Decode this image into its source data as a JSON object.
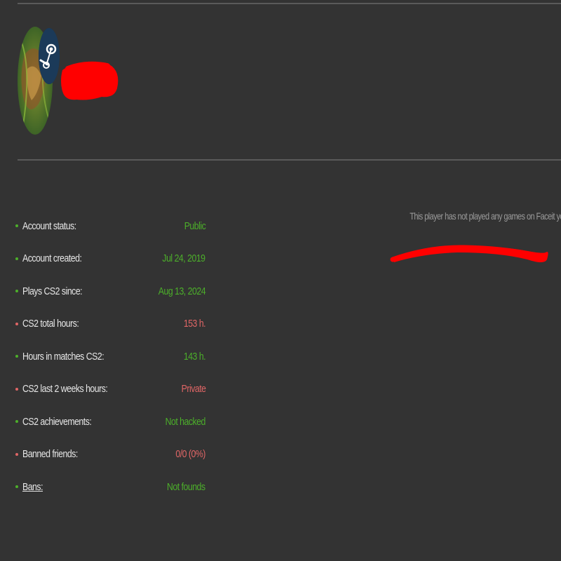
{
  "profile": {
    "avatar_icon": "player-avatar",
    "badge_icon": "steam-icon"
  },
  "stats": {
    "rows": [
      {
        "label": "Account status:",
        "value": "Public",
        "status": "good"
      },
      {
        "label": "Account created:",
        "value": "Jul 24, 2019",
        "status": "good"
      },
      {
        "label": "Plays CS2 since:",
        "value": "Aug 13, 2024",
        "status": "good"
      },
      {
        "label": "CS2 total hours:",
        "value": "153 h.",
        "status": "bad"
      },
      {
        "label": "Hours in matches CS2:",
        "value": "143 h.",
        "status": "good"
      },
      {
        "label": "CS2 last 2 weeks hours:",
        "value": "Private",
        "status": "bad"
      },
      {
        "label": "CS2 achievements:",
        "value": "Not hacked",
        "status": "good"
      },
      {
        "label": "Banned friends:",
        "value": "0/0 (0%)",
        "status": "bad"
      },
      {
        "label": "Bans:",
        "value": "Not founds",
        "status": "good"
      }
    ]
  },
  "faceit": {
    "message": "This player has not played any games on Faceit yet"
  },
  "colors": {
    "background": "#333333",
    "good": "#4caf2a",
    "bad": "#e06666",
    "redaction": "#ff0000"
  }
}
